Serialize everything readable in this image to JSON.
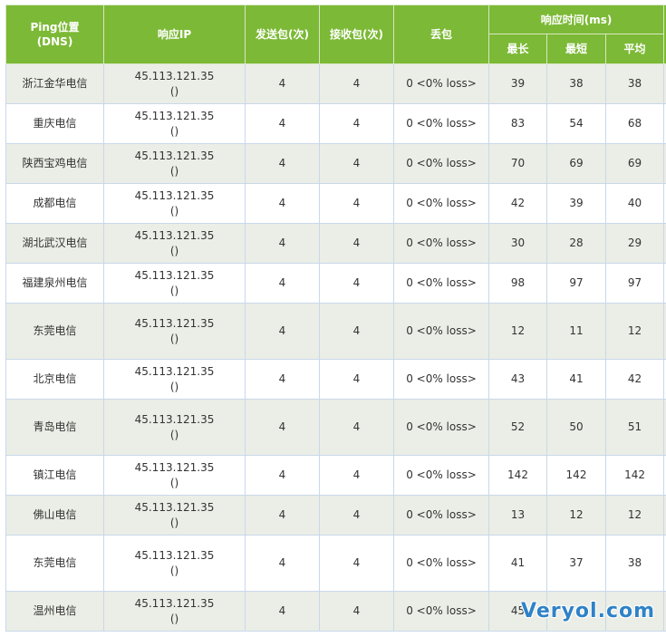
{
  "header": {
    "location": "Ping位置\n(DNS)",
    "ip": "响应IP",
    "sent": "发送包(次)",
    "received": "接收包(次)",
    "loss": "丢包",
    "response_time": "响应时间(ms)",
    "max": "最长",
    "min": "最短",
    "avg": "平均"
  },
  "rows": [
    {
      "location": "浙江金华电信",
      "ip": "45.113.121.35",
      "ip_sub": "()",
      "sent": "4",
      "received": "4",
      "loss": "0 <0% loss>",
      "max": "39",
      "min": "38",
      "avg": "38"
    },
    {
      "location": "重庆电信",
      "ip": "45.113.121.35",
      "ip_sub": "()",
      "sent": "4",
      "received": "4",
      "loss": "0 <0% loss>",
      "max": "83",
      "min": "54",
      "avg": "68"
    },
    {
      "location": "陕西宝鸡电信",
      "ip": "45.113.121.35",
      "ip_sub": "()",
      "sent": "4",
      "received": "4",
      "loss": "0 <0% loss>",
      "max": "70",
      "min": "69",
      "avg": "69"
    },
    {
      "location": "成都电信",
      "ip": "45.113.121.35",
      "ip_sub": "()",
      "sent": "4",
      "received": "4",
      "loss": "0 <0% loss>",
      "max": "42",
      "min": "39",
      "avg": "40"
    },
    {
      "location": "湖北武汉电信",
      "ip": "45.113.121.35",
      "ip_sub": "()",
      "sent": "4",
      "received": "4",
      "loss": "0 <0% loss>",
      "max": "30",
      "min": "28",
      "avg": "29"
    },
    {
      "location": "福建泉州电信",
      "ip": "45.113.121.35",
      "ip_sub": "()",
      "sent": "4",
      "received": "4",
      "loss": "0 <0% loss>",
      "max": "98",
      "min": "97",
      "avg": "97"
    },
    {
      "location": "东莞电信",
      "ip": "45.113.121.35",
      "ip_sub": "()",
      "sent": "4",
      "received": "4",
      "loss": "0 <0% loss>",
      "max": "12",
      "min": "11",
      "avg": "12"
    },
    {
      "location": "北京电信",
      "ip": "45.113.121.35",
      "ip_sub": "()",
      "sent": "4",
      "received": "4",
      "loss": "0 <0% loss>",
      "max": "43",
      "min": "41",
      "avg": "42"
    },
    {
      "location": "青岛电信",
      "ip": "45.113.121.35",
      "ip_sub": "()",
      "sent": "4",
      "received": "4",
      "loss": "0 <0% loss>",
      "max": "52",
      "min": "50",
      "avg": "51"
    },
    {
      "location": "镇江电信",
      "ip": "45.113.121.35",
      "ip_sub": "()",
      "sent": "4",
      "received": "4",
      "loss": "0 <0% loss>",
      "max": "142",
      "min": "142",
      "avg": "142"
    },
    {
      "location": "佛山电信",
      "ip": "45.113.121.35",
      "ip_sub": "()",
      "sent": "4",
      "received": "4",
      "loss": "0 <0% loss>",
      "max": "13",
      "min": "12",
      "avg": "12"
    },
    {
      "location": "东莞电信",
      "ip": "45.113.121.35",
      "ip_sub": "()",
      "sent": "4",
      "received": "4",
      "loss": "0 <0% loss>",
      "max": "41",
      "min": "37",
      "avg": "38"
    },
    {
      "location": "温州电信",
      "ip": "45.113.121.35",
      "ip_sub": "()",
      "sent": "4",
      "received": "4",
      "loss": "0 <0% loss>",
      "max": "45",
      "min": "",
      "avg": ""
    }
  ],
  "watermark": "Veryol.com",
  "colors": {
    "header_bg": "#7cb936",
    "row_alt_bg": "#ebeee6",
    "border": "#c9d8ea",
    "watermark": "#2f82c7"
  }
}
